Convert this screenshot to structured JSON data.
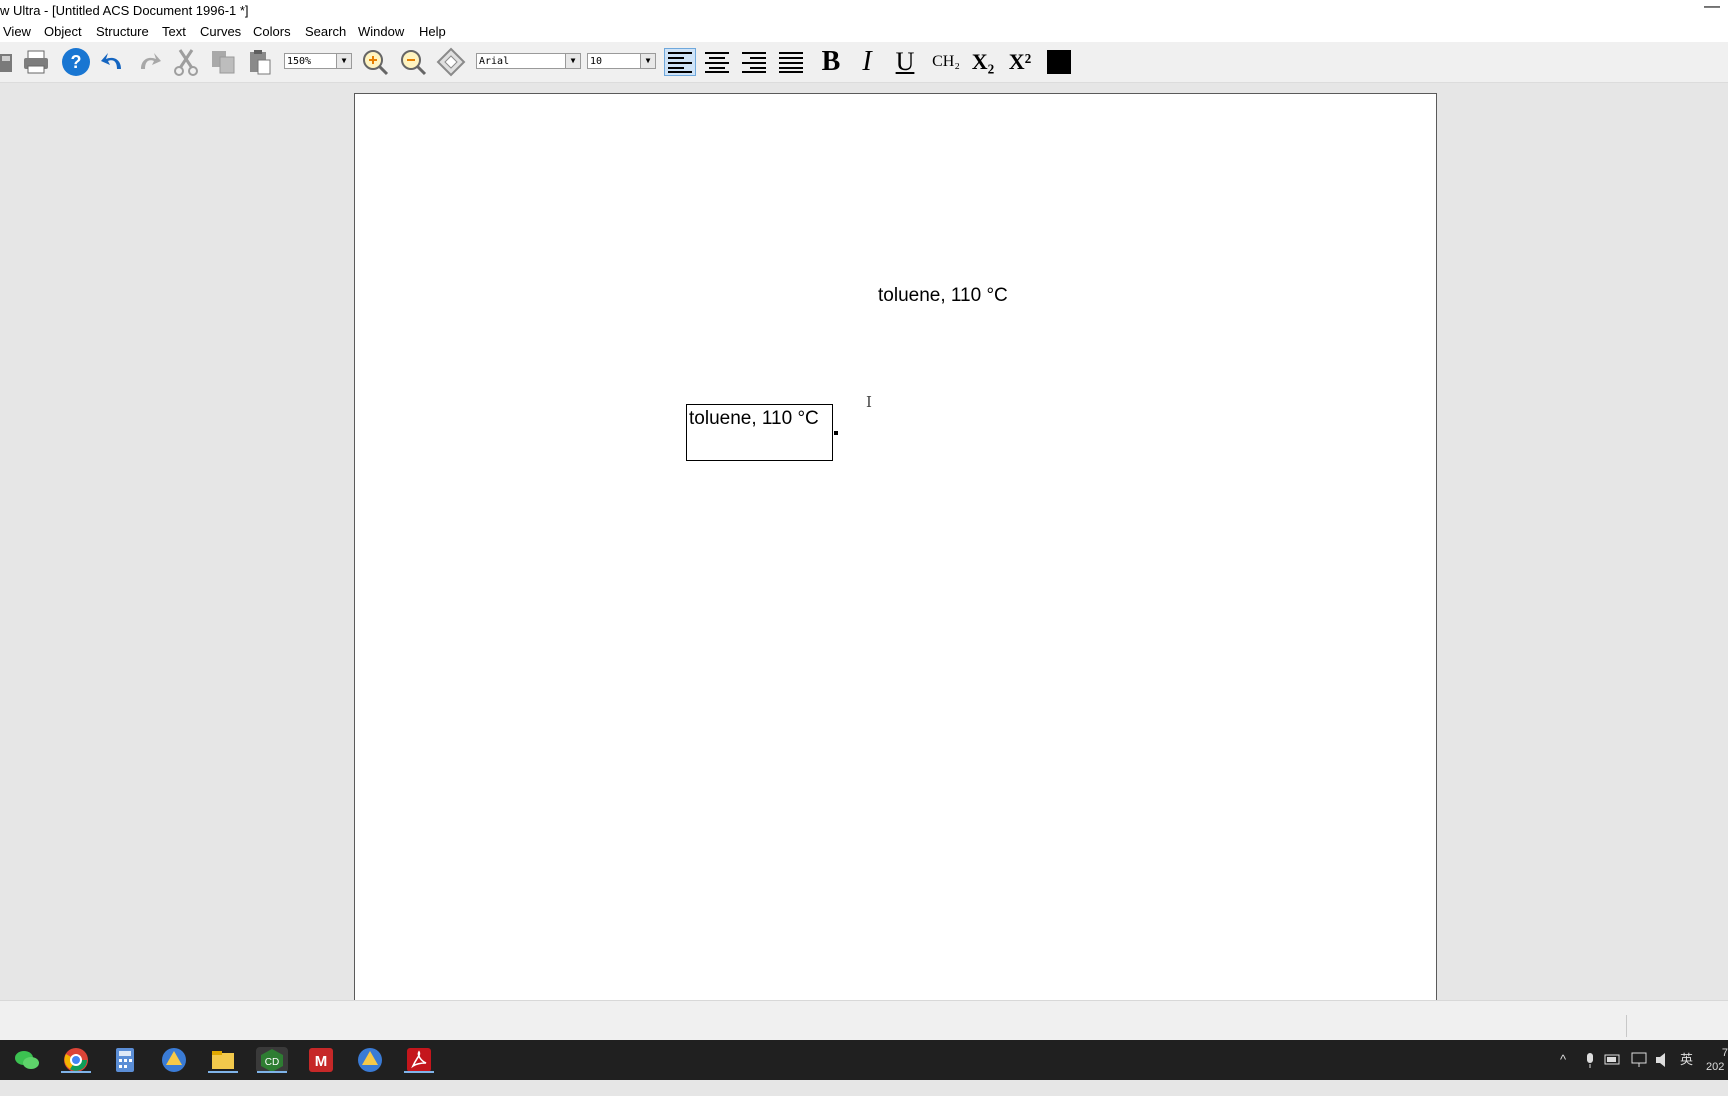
{
  "window": {
    "title": "w Ultra - [Untitled ACS Document 1996-1 *]",
    "minimize_glyph": "—"
  },
  "menu": {
    "items": [
      "View",
      "Object",
      "Structure",
      "Text",
      "Curves",
      "Colors",
      "Search",
      "Window",
      "Help"
    ]
  },
  "toolbar": {
    "zoom_value": "150%",
    "font_value": "Arial",
    "size_value": "10",
    "ch2_label": "CH₂",
    "sub_label": "X₂",
    "sup_label": "X²",
    "bold_label": "B",
    "italic_label": "I",
    "underline_label": "U",
    "color_swatch": "#000000",
    "icons": [
      "save-icon",
      "print-icon",
      "help-icon",
      "undo-icon",
      "redo-icon",
      "cut-icon",
      "copy-icon",
      "paste-icon",
      "zoom-in-icon",
      "zoom-out-icon",
      "eraser-icon",
      "align-left-icon",
      "align-center-icon",
      "align-right-icon",
      "justify-icon"
    ]
  },
  "document": {
    "text_plain": "toluene, 110 °C",
    "text_selected": "toluene, 110 °C"
  },
  "taskbar": {
    "apps": [
      "wechat-icon",
      "chrome-icon",
      "calculator-icon",
      "app-icon",
      "file-explorer-icon",
      "chemdraw-icon",
      "matlab-icon",
      "app-icon-2",
      "acrobat-icon"
    ],
    "tray_ime": "英",
    "clock_line1": "7",
    "clock_line2": "202"
  }
}
